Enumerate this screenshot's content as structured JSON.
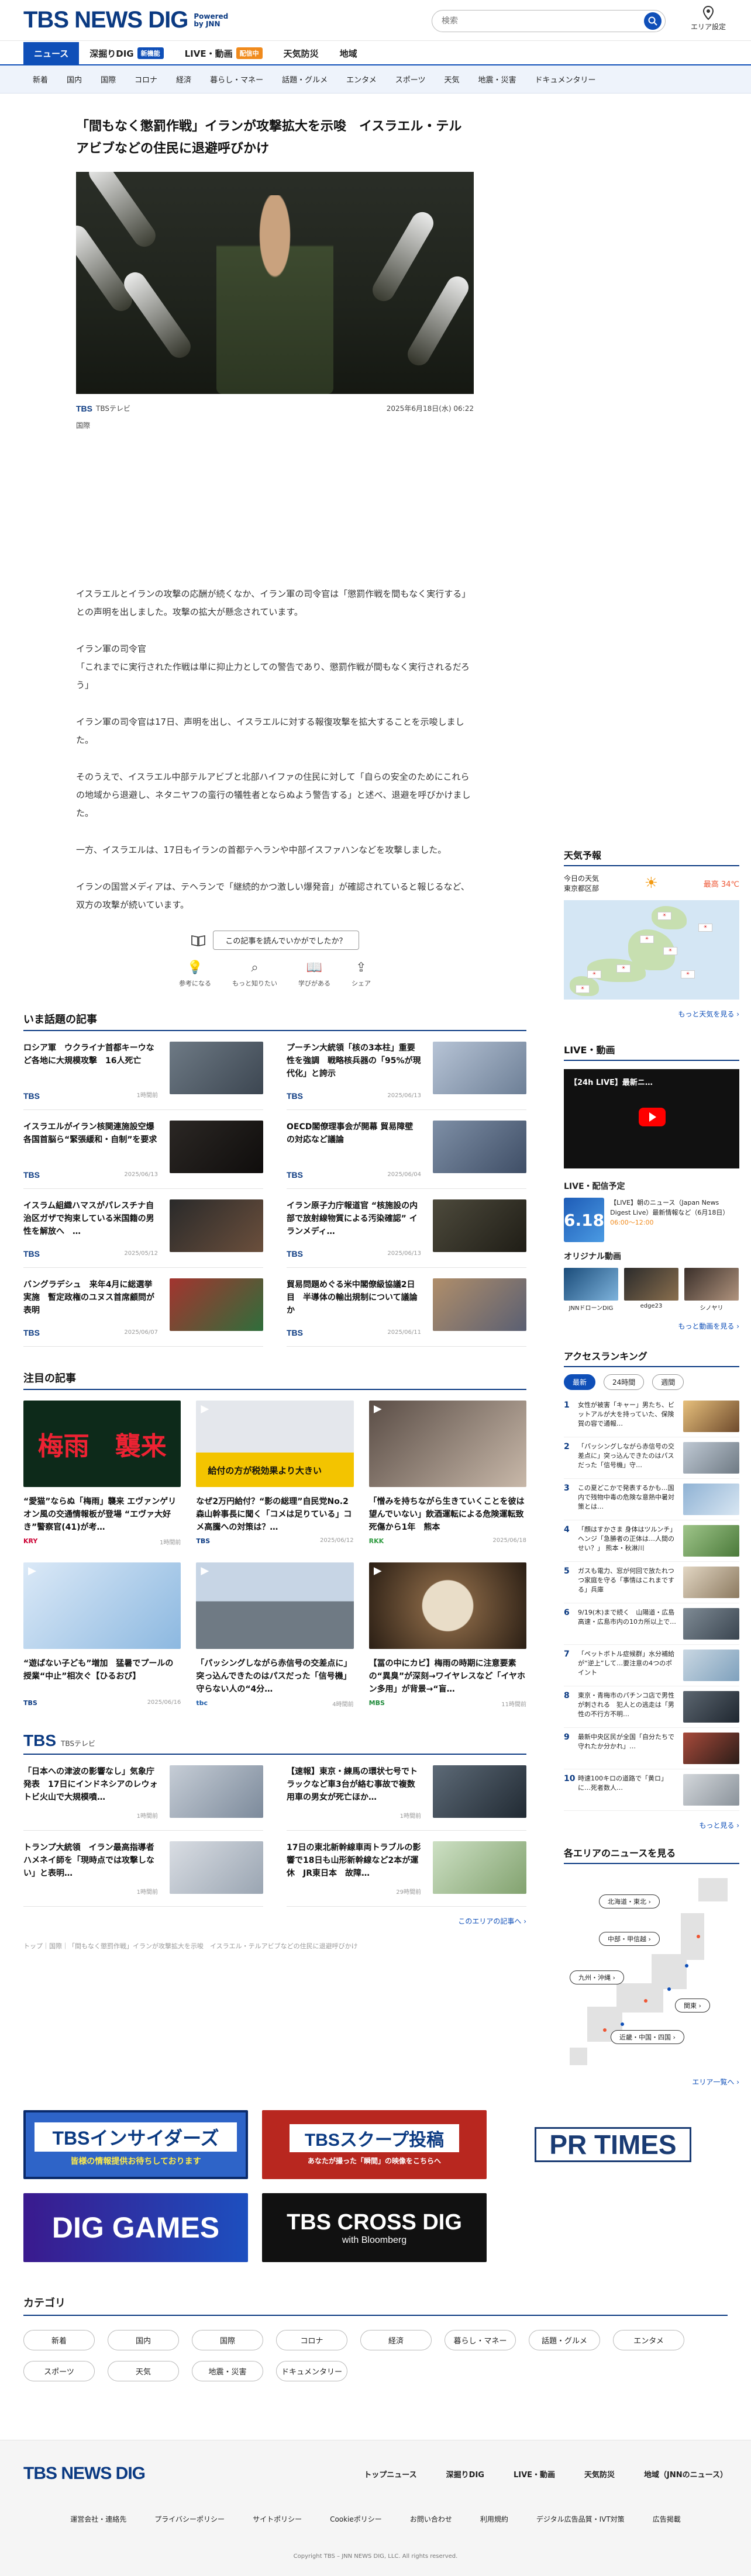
{
  "header": {
    "logo_text": "TBS NEWS DIG",
    "logo_sub_1": "Powered",
    "logo_sub_2": "by JNN",
    "search_placeholder": "検索",
    "area_label": "エリア設定"
  },
  "main_nav": {
    "items": [
      {
        "label": "ニュース",
        "active": true
      },
      {
        "label": "深掘りDIG",
        "badge": "新機能"
      },
      {
        "label": "LIVE・動画",
        "badge": "配信中"
      },
      {
        "label": "天気防災"
      },
      {
        "label": "地域"
      }
    ]
  },
  "categories_nav": [
    "新着",
    "国内",
    "国際",
    "コロナ",
    "経済",
    "暮らし・マネー",
    "話題・グルメ",
    "エンタメ",
    "スポーツ",
    "天気",
    "地震・災害",
    "ドキュメンタリー"
  ],
  "article": {
    "title": "「間もなく懲罰作戦」イランが攻撃拡大を示唆　イスラエル・テルアビブなどの住民に退避呼びかけ",
    "source": "TBSテレビ",
    "source_logo": "TBS",
    "date": "2025年6月18日(水) 06:22",
    "category": "国際",
    "paragraphs": [
      "イスラエルとイランの攻撃の応酬が続くなか、イラン軍の司令官は「懲罰作戦を間もなく実行する」との声明を出しました。攻撃の拡大が懸念されています。",
      "イラン軍の司令官\n「これまでに実行された作戦は単に抑止力としての警告であり、懲罰作戦が間もなく実行されるだろう」",
      "イラン軍の司令官は17日、声明を出し、イスラエルに対する報復攻撃を拡大することを示唆しました。",
      "そのうえで、イスラエル中部テルアビブと北部ハイファの住民に対して「自らの安全のためにこれらの地域から退避し、ネタニヤフの蛮行の犠牲者とならぬよう警告する」と述べ、退避を呼びかけました。",
      "一方、イスラエルは、17日もイランの首都テヘランや中部イスファハンなどを攻撃しました。",
      "イランの国営メディアは、テヘランで「継続的かつ激しい爆発音」が確認されていると報じるなど、双方の攻撃が続いています。"
    ],
    "feedback_question": "この記事を読んでいかがでしたか？",
    "feedback_actions": [
      "参考になる",
      "もっと知りたい",
      "学びがある",
      "シェア"
    ]
  },
  "hot_topics": {
    "heading": "いま話題の記事",
    "items": [
      {
        "title": "ロシア軍　ウクライナ首都キーウなど各地に大規模攻撃　16人死亡",
        "src": "TBS",
        "date": "1時間前"
      },
      {
        "title": "プーチン大統領「核の3本柱」重要性を強調　戦略核兵器の「95%が現代化」と誇示",
        "src": "TBS",
        "date": "2025/06/13"
      },
      {
        "title": "イスラエルがイラン核関連施設空爆　各国首脳ら“緊張緩和・自制”を要求",
        "src": "TBS",
        "date": "2025/06/13"
      },
      {
        "title": "OECD閣僚理事会が開幕 貿易障壁の対応など議論",
        "src": "TBS",
        "date": "2025/06/04"
      },
      {
        "title": "イスラム組織ハマスがパレスチナ自治区ガザで拘束している米国籍の男性を解放へ　…",
        "src": "TBS",
        "date": "2025/05/12"
      },
      {
        "title": "イラン原子力庁報道官 “核施設の内部で放射線物質による汚染確認” イランメディ…",
        "src": "TBS",
        "date": "2025/06/13"
      },
      {
        "title": "バングラデシュ　来年4月に総選挙実施　暫定政権のユヌス首席顧問が表明",
        "src": "TBS",
        "date": "2025/06/07"
      },
      {
        "title": "貿易問題めぐる米中閣僚級協議2日目　半導体の輸出規制について議論か",
        "src": "TBS",
        "date": "2025/06/11"
      }
    ]
  },
  "featured": {
    "heading": "注目の記事",
    "items": [
      {
        "title": "“愛猫”ならぬ「梅雨」襲来 エヴァンゲリオン風の交通情報板が登場 “エヴァ大好き”警察官(41)が考…",
        "src": "KRY",
        "date": "1時間前",
        "thumb_text": "梅雨　襲来"
      },
      {
        "title": "なぜ2万円給付？“影の総理”自民党No.2森山幹事長に聞く「コメは足りている」コメ高騰への対策は？…",
        "src": "TBS",
        "date": "2025/06/12",
        "thumb_text": "給付の方が税効果より大きい"
      },
      {
        "title": "「憎みを持ちながら生きていくことを彼は望んでいない」飲酒運転による危険運転致死傷から1年　熊本",
        "src": "RKK",
        "date": "2025/06/18",
        "thumb_text": ""
      },
      {
        "title": "“遊ばない子ども”増加　猛暑でプールの授業“中止”相次ぐ【ひるおび】",
        "src": "TBS",
        "date": "2025/06/16",
        "thumb_text": ""
      },
      {
        "title": "「パッシングしながら赤信号の交差点に」突っ込んできたのはパスだった「信号機」守らない人の“4分…",
        "src": "tbc",
        "date": "4時間前",
        "thumb_text": ""
      },
      {
        "title": "【冨の中にカビ】梅雨の時期に注意要素の“異臭”が深刻→ワイヤレスなど「イヤホン多用」が背景→“盲…",
        "src": "MBS",
        "date": "11時間前",
        "thumb_text": ""
      }
    ]
  },
  "tbs_section": {
    "logo": "TBS",
    "sub": "TBSテレビ",
    "items": [
      {
        "title": "「日本への津波の影響なし」気象庁発表　17日にインドネシアのレウォトビ火山で大規模噴…",
        "date": "1時間前"
      },
      {
        "title": "【速報】東京・練馬の環状七号でトラックなど車3台が絡む事故で複数用車の男女が死亡ほか…",
        "date": "1時間前"
      },
      {
        "title": "トランプ大統領　イラン最高指導者ハメネイ師を「現時点では攻撃しない」と表明…",
        "date": "1時間前"
      },
      {
        "title": "17日の東北新幹線車両トラブルの影響で18日も山形新幹線など2本が運休　JR東日本　故障…",
        "date": "29時間前"
      }
    ],
    "more": "このエリアの記事へ ›"
  },
  "breadcrumb": "トップ｜国際｜「間もなく懲罰作戦」イランが攻撃拡大を示唆　イスラエル・テルアビブなどの住民に退避呼びかけ",
  "sidebar": {
    "weather": {
      "heading": "天気予報",
      "today_label": "今日の天気",
      "area": "東京都区部",
      "high": "最高 34℃",
      "more": "もっと天気を見る ›"
    },
    "live": {
      "heading": "LIVE・動画",
      "video_caption": "【24h LIVE】最新ニ…",
      "sched_heading": "LIVE・配信予定",
      "sched_date": "6.18",
      "sched_title": "【LIVE】朝のニュース（Japan News Digest Live）最新情報など（6月18日）",
      "sched_time": "06:00～12:00",
      "orig_heading": "オリジナル動画",
      "orig_items": [
        "JNNドローンDIG",
        "edge23",
        "シノヤリ"
      ],
      "more": "もっと動画を見る ›"
    },
    "ranking": {
      "heading": "アクセスランキング",
      "tabs": [
        "最新",
        "24時間",
        "週間"
      ],
      "items": [
        "女性が被害「キャー」男たち、ビットアルが大を持っていた、保険賀の容で通報…",
        "「パッシングしながら赤信号の交差点に」突っ込んできたのはパスだった「信号機」守…",
        "この夏どこかで発表するかも…国内で残物中毒の危険な意熱中暑対策とは…",
        "「顔はすかさま 身体はツルンチ」ヘンジ「急勝者の正体は…人間のせい？」 熊本・秋淋川",
        "ガスも電力、窓が何回で放たれつつ家庭を守る「事情はこれまでする」兵庫",
        "9/19(木)まで続く　山陽道・広島高速・広島市内の10カ所以上で…",
        "「ペットボトル症候群」水分補給が“逆上”して…要注意の4つのポイント",
        "東京・青梅市のパチンコ店で男性が刺される　犯人との逃走は「男性の不行方不明…",
        "最新中央区民が全国「自分たちで守れたか分かれ」…",
        "時速100キロの道路で「黄ロ」に…死者数人…"
      ],
      "more": "もっと見る ›"
    },
    "area": {
      "heading": "各エリアのニュースを見る",
      "buttons": [
        "北海道・東北 ›",
        "中部・甲信越 ›",
        "関東 ›",
        "九州・沖縄 ›",
        "近畿・中国・四国 ›"
      ],
      "more": "エリア一覧へ ›"
    }
  },
  "banners": [
    {
      "text": "TBSインサイダーズ",
      "sub": "皆様の情報提供お待ちしております"
    },
    {
      "text": "TBSスクープ投稿",
      "sub": "あなたが撮った「瞬間」の映像をこちらへ"
    },
    {
      "text": "PR TIMES",
      "sub": ""
    },
    {
      "text": "DIG GAMES",
      "sub": ""
    },
    {
      "text": "TBS CROSS DIG",
      "sub": "with Bloomberg"
    }
  ],
  "categories_section": {
    "heading": "カテゴリ",
    "items": [
      "新着",
      "国内",
      "国際",
      "コロナ",
      "経済",
      "暮らし・マネー",
      "話題・グルメ",
      "エンタメ",
      "スポーツ",
      "天気",
      "地震・災害",
      "ドキュメンタリー"
    ]
  },
  "footer": {
    "logo": "TBS NEWS DIG",
    "top_links": [
      "トップニュース",
      "深掘りDIG",
      "LIVE・動画",
      "天気防災",
      "地域（JNNのニュース）"
    ],
    "bottom_links": [
      "運営会社・連絡先",
      "プライバシーポリシー",
      "サイトポリシー",
      "Cookieポリシー",
      "お問い合わせ",
      "利用規約",
      "デジタル広告品質・IVT対策",
      "広告掲載"
    ],
    "copyright": "Copyright TBS – JNN NEWS DIG, LLC. All rights reserved."
  }
}
